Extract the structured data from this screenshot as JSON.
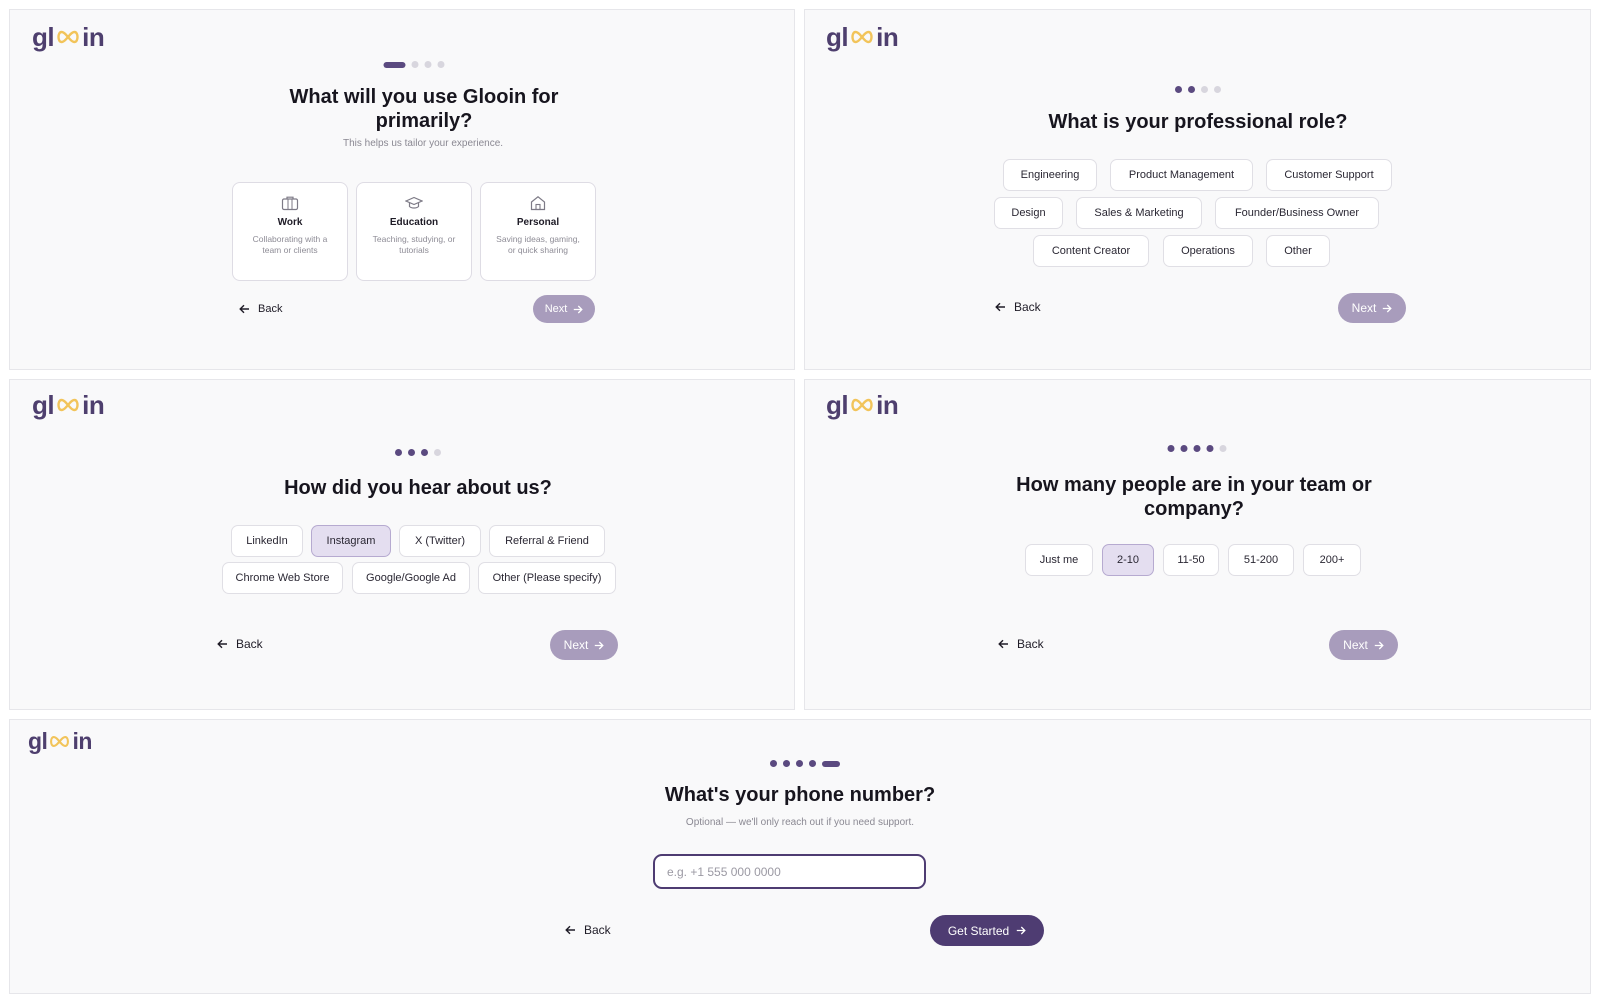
{
  "brand": {
    "logo_left": "gl",
    "logo_right": "in",
    "accent": "#4e3c72",
    "infinity_color": "#f2c45a"
  },
  "step1": {
    "title": "What will you use Glooin for primarily?",
    "subtitle": "This helps us tailor your experience.",
    "cards": [
      {
        "icon": "briefcase-icon",
        "title": "Work",
        "desc": "Collaborating with a team or clients"
      },
      {
        "icon": "graduation-cap-icon",
        "title": "Education",
        "desc": "Teaching, studying, or tutorials"
      },
      {
        "icon": "home-icon",
        "title": "Personal",
        "desc": "Saving ideas, gaming, or quick sharing"
      }
    ],
    "back": "Back",
    "next": "Next"
  },
  "step2": {
    "title": "What is your professional role?",
    "options": [
      "Engineering",
      "Product Management",
      "Customer Support",
      "Design",
      "Sales & Marketing",
      "Founder/Business Owner",
      "Content Creator",
      "Operations",
      "Other"
    ],
    "back": "Back",
    "next": "Next"
  },
  "step3": {
    "title": "How did you hear about us?",
    "options": [
      "LinkedIn",
      "Instagram",
      "X (Twitter)",
      "Referral & Friend",
      "Chrome Web Store",
      "Google/Google Ad",
      "Other (Please specify)"
    ],
    "selected": "Instagram",
    "back": "Back",
    "next": "Next"
  },
  "step4": {
    "title": "How many people are in your team or company?",
    "options": [
      "Just me",
      "2-10",
      "11-50",
      "51-200",
      "200+"
    ],
    "selected": "2-10",
    "back": "Back",
    "next": "Next"
  },
  "step5": {
    "title": "What's your phone number?",
    "subtitle": "Optional — we'll only reach out if you need support.",
    "phone_placeholder": "e.g. +1 555 000 0000",
    "phone_value": "",
    "back": "Back",
    "submit": "Get Started"
  }
}
